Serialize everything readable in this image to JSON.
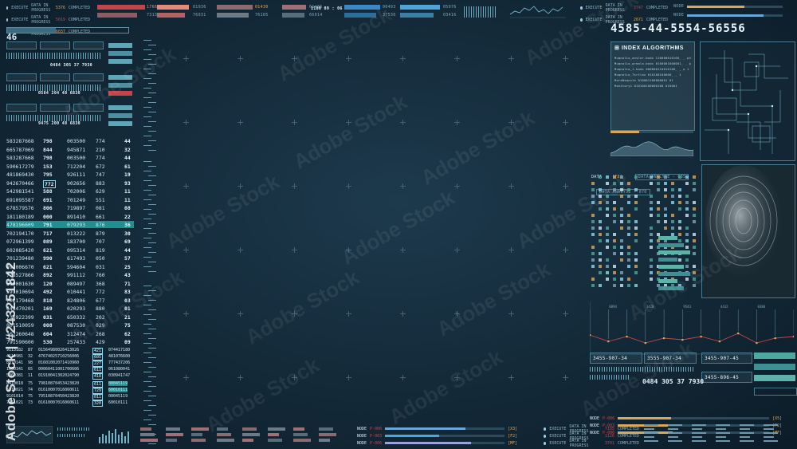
{
  "top_bar": {
    "status_groups": [
      {
        "execute": "EXECUTE",
        "data": "DATA IN PROGRESS",
        "value1": "5376",
        "completed": "COMPLETED",
        "value2": "5756"
      },
      {
        "execute": "EXECUTE",
        "data": "DATA IN PROGRESS",
        "value1": "5019",
        "completed": "COMPLETED",
        "value2": "3745"
      },
      {
        "execute": "EXECUTE",
        "data": "DATA IN PROGRESS",
        "value1": "6037",
        "completed": "COMPLETED",
        "value2": "5587"
      }
    ],
    "meter_values": [
      "17664",
      "73135",
      "01936",
      "76031",
      "01430",
      "76105",
      "61436",
      "66014",
      "00493",
      "37530",
      "05976",
      "03416"
    ],
    "timecode": "1180 09 : 06 09",
    "right_status": [
      {
        "execute": "EXECUTE",
        "data": "DATA IN PROGRESS",
        "value": "3747",
        "completed": "COMPLETED"
      },
      {
        "execute": "EXECUTE",
        "data": "DATA IN PROGRESS",
        "value": "2671",
        "completed": "COMPLETED"
      }
    ],
    "node_labels": [
      "NODE",
      "NODE"
    ]
  },
  "left_panel": {
    "counter": "46",
    "module_codes": [
      "0484 305 37 7930",
      "0584 204 48 6830",
      "9475 200 48 6830"
    ],
    "table_rows": [
      [
        "583287668",
        "798",
        "003500",
        "774",
        "44"
      ],
      [
        "665787069",
        "844",
        "945871",
        "210",
        "32"
      ],
      [
        "583287668",
        "798",
        "003500",
        "774",
        "44"
      ],
      [
        "590617279",
        "153",
        "712204",
        "672",
        "61"
      ],
      [
        "481869430",
        "795",
        "926111",
        "747",
        "19"
      ],
      [
        "942670466",
        "772",
        "902656",
        "883",
        "93"
      ],
      [
        "542981541",
        "588",
        "702006",
        "629",
        "11"
      ],
      [
        "691095587",
        "691",
        "701249",
        "551",
        "11"
      ],
      [
        "678579576",
        "806",
        "719897",
        "081",
        "08"
      ],
      [
        "181180189",
        "000",
        "891410",
        "661",
        "22"
      ],
      [
        "478196609",
        "791",
        "079293",
        "876",
        "36"
      ],
      [
        "702194170",
        "717",
        "013222",
        "879",
        "30"
      ],
      [
        "072961399",
        "089",
        "183700",
        "707",
        "69"
      ],
      [
        "602085420",
        "621",
        "095314",
        "819",
        "44"
      ],
      [
        "701239480",
        "990",
        "617493",
        "050",
        "57"
      ],
      [
        "692006670",
        "621",
        "594604",
        "031",
        "25"
      ],
      [
        "778527866",
        "892",
        "991112",
        "760",
        "43"
      ],
      [
        "599001630",
        "120",
        "089497",
        "368",
        "71"
      ],
      [
        "591010694",
        "492",
        "010441",
        "772",
        "83"
      ],
      [
        "702179468",
        "818",
        "824806",
        "677",
        "03"
      ],
      [
        "641470201",
        "169",
        "020293",
        "880",
        "01"
      ],
      [
        "736922399",
        "031",
        "650332",
        "202",
        "21"
      ],
      [
        "801510059",
        "008",
        "087530",
        "029",
        "75"
      ],
      [
        "102260648",
        "604",
        "312474",
        "268",
        "62"
      ],
      [
        "791590600",
        "530",
        "257433",
        "429",
        "09"
      ]
    ],
    "lower_rows": [
      [
        "9113182",
        "87",
        "01564980026413026",
        "421",
        "074417180"
      ],
      [
        "4110981",
        "32",
        "47674025710256006",
        "605",
        "481076600"
      ],
      [
        "8010141",
        "98",
        "01601002071410960",
        "227",
        "777437206"
      ],
      [
        "1000341",
        "65",
        "00060411001700606",
        "611",
        "061080041"
      ],
      [
        "5060381",
        "11",
        "01910041302024790",
        "418",
        "030941747"
      ]
    ],
    "lower_rows_2": [
      [
        "8410018",
        "75",
        "79810870453423820",
        "611",
        "00045119"
      ],
      [
        "6810021",
        "74",
        "01610007016060611",
        "729",
        "60010111"
      ],
      [
        "9101014",
        "75",
        "79510870450423820",
        "011",
        "00045119"
      ],
      [
        "7411021",
        "73",
        "01610007016060611",
        "320",
        "60010111"
      ]
    ]
  },
  "right_panel": {
    "big_code": "4585-44-5554-56556",
    "index_title": "INDEX ALGORITHMS",
    "index_lines": [
      "Muqnalio_anslar.bodx   110000010100_ _ phrmtte tr7  31 ",
      "Muqnalio_grmala.bodx   0100001000001_ _ phoenix tr7 ",
      "Muqnalio_1.bodx        000000110010100_ _ p   1 ",
      "Muqnalio_Tsrtlax       010100100000_ _ 1 ",
      "MoraNsquvie            010001100000001 01 ",
      "Monitory1              010100100000100 010001 "
    ],
    "data_label": "DATA",
    "data_tag": "[F8]",
    "analyse_1": "DATA ANALYSE - 035",
    "analyse_2": "DATA ANALYSE - 070",
    "code_boxes": [
      "3455-907-34",
      "3555-907-34",
      "3455-907-45",
      "3455-896-45"
    ],
    "bottom_code": "0484 305 37 7930",
    "node_rows": [
      {
        "node": "NODE",
        "id": "P-006",
        "fill": 0.35,
        "tag": "[X5]",
        "color": "#d9a75a"
      },
      {
        "node": "NODE",
        "id": "P-003",
        "fill": 0.33,
        "tag": "[F2]",
        "color": "#d9a75a"
      },
      {
        "node": "NODE",
        "id": "P-006",
        "fill": 0.36,
        "tag": "[MF]",
        "color": "#d9a75a"
      }
    ],
    "wave_labels": [
      "1024",
      "0894",
      "3325",
      "1420",
      "0021",
      "9543",
      "0112",
      "4432",
      "7751",
      "0380",
      "2214",
      "6602"
    ]
  },
  "bottom_bar": {
    "node_rows": [
      {
        "node": "NODE",
        "id": "P-006",
        "fill": 0.67,
        "tag": "[X3]",
        "color": "#6aa6d9"
      },
      {
        "node": "NODE",
        "id": "P-003",
        "fill": 0.45,
        "tag": "[F2]",
        "color": "#48a8e0"
      },
      {
        "node": "NODE",
        "id": "P-006",
        "fill": 0.72,
        "tag": "[MF]",
        "color": "#9aa2dd"
      }
    ],
    "status_groups": [
      {
        "execute": "EXECUTE",
        "data": "DATA IN PROGRESS",
        "value": "7105",
        "completed": "COMPLETED"
      },
      {
        "execute": "EXECUTE",
        "data": "DATA IN PROGRESS",
        "value": "1126",
        "completed": "COMPLETED"
      },
      {
        "execute": "EXECUTE",
        "data": "DATA IN PROGRESS",
        "value": "3701",
        "completed": "COMPLETED"
      }
    ]
  },
  "watermark": {
    "text": "Adobe Stock",
    "vertical": "Adobe Stock | #243251842"
  },
  "colors": {
    "accent_teal": "#1f8f8f",
    "accent_orange": "#d9a75a",
    "accent_blue": "#48a8e0",
    "accent_red": "#c2454c",
    "text": "#cfe9f5"
  }
}
